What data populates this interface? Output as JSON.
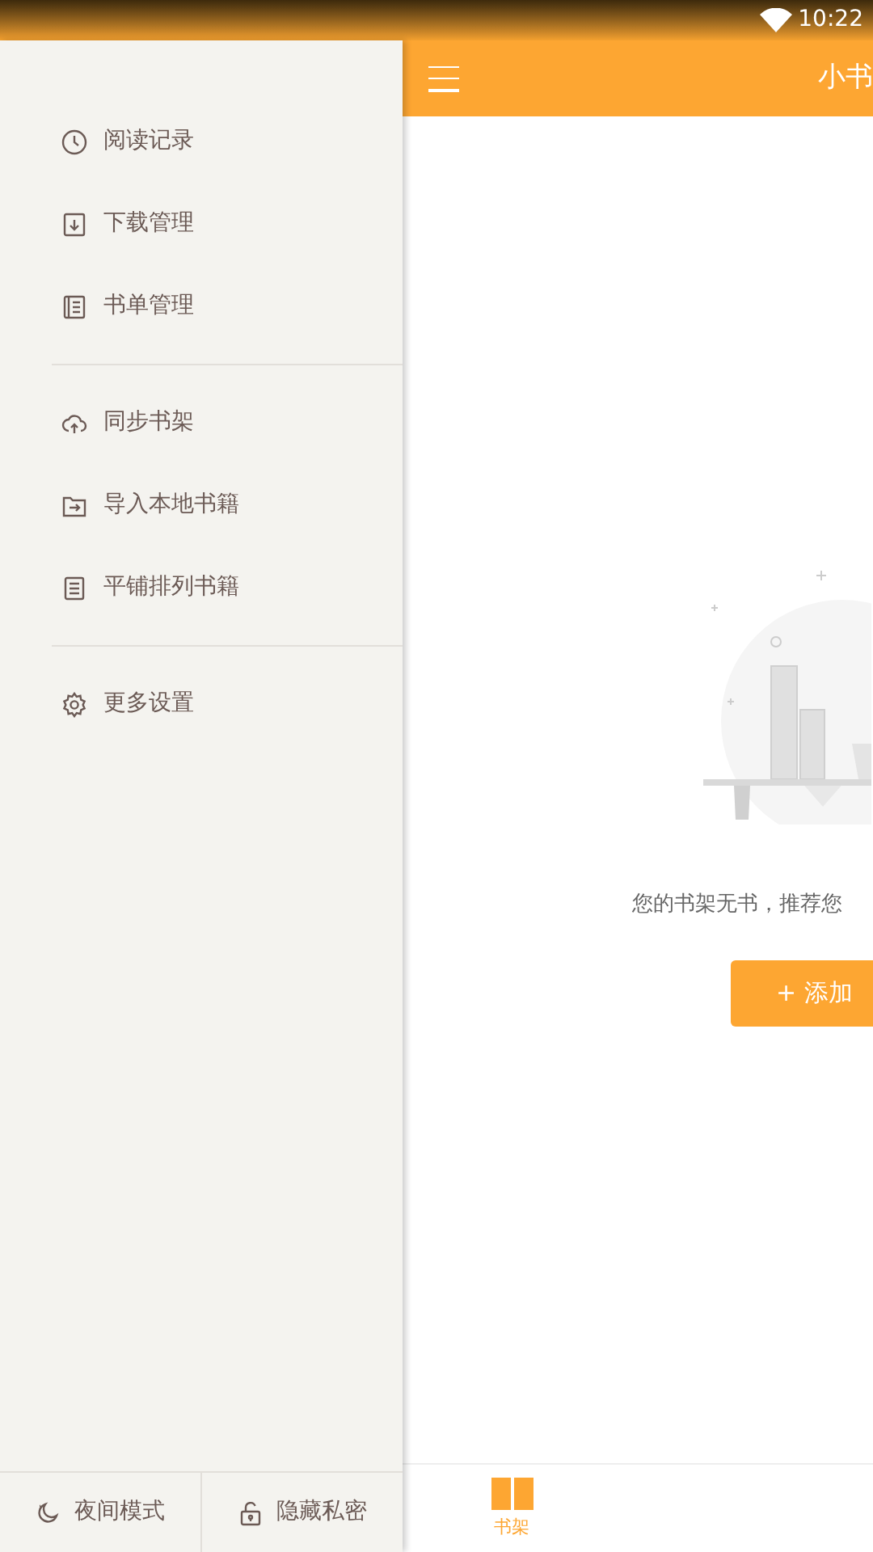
{
  "status_bar": {
    "time": "10:22"
  },
  "drawer": {
    "sections": [
      {
        "items": [
          {
            "label": "阅读记录"
          },
          {
            "label": "下载管理"
          },
          {
            "label": "书单管理"
          }
        ]
      },
      {
        "items": [
          {
            "label": "同步书架"
          },
          {
            "label": "导入本地书籍"
          },
          {
            "label": "平铺排列书籍"
          }
        ]
      },
      {
        "items": [
          {
            "label": "更多设置"
          }
        ]
      }
    ],
    "footer": [
      {
        "label": "夜间模式"
      },
      {
        "label": "隐藏私密"
      }
    ]
  },
  "app_bar": {
    "title": "小书"
  },
  "empty_state": {
    "message": "您的书架无书，推荐您",
    "button": "+ 添加"
  },
  "bottom_nav": [
    {
      "label": "书架",
      "selected": true
    }
  ]
}
